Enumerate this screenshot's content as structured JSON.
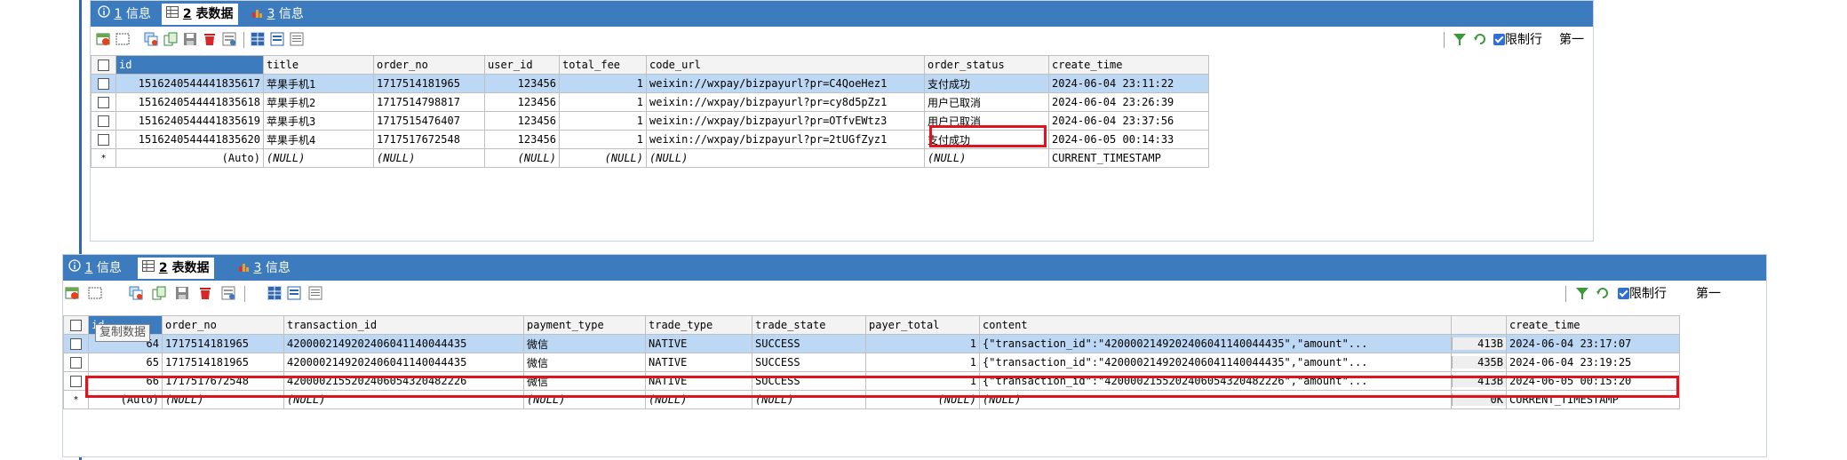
{
  "colors": {
    "tabbar": "#3d7bbf",
    "selection": "#bcd8f4",
    "highlight": "#e0141e"
  },
  "panel1": {
    "tabs": [
      {
        "num": "1",
        "label": "信息",
        "icon": "info-icon"
      },
      {
        "num": "2",
        "label": "表数据",
        "icon": "table-icon"
      },
      {
        "num": "3",
        "label": "信息",
        "icon": "bar-chart-icon"
      }
    ],
    "toolbar": {
      "limit_label": "限制行",
      "first_label": "第一"
    },
    "columns": [
      "id",
      "title",
      "order_no",
      "user_id",
      "total_fee",
      "code_url",
      "order_status",
      "create_time"
    ],
    "rows": [
      [
        "1516240544441835617",
        "苹果手机1",
        "1717514181965",
        "123456",
        "1",
        "weixin://wxpay/bizpayurl?pr=C4QoeHez1",
        "支付成功",
        "2024-06-04 23:11:22"
      ],
      [
        "1516240544441835618",
        "苹果手机2",
        "1717514798817",
        "123456",
        "1",
        "weixin://wxpay/bizpayurl?pr=cy8d5pZz1",
        "用户已取消",
        "2024-06-04 23:26:39"
      ],
      [
        "1516240544441835619",
        "苹果手机3",
        "1717515476407",
        "123456",
        "1",
        "weixin://wxpay/bizpayurl?pr=OTfvEWtz3",
        "用户已取消",
        "2024-06-04 23:37:56"
      ],
      [
        "1516240544441835620",
        "苹果手机4",
        "1717517672548",
        "123456",
        "1",
        "weixin://wxpay/bizpayurl?pr=2tUGfZyz1",
        "支付成功",
        "2024-06-05 00:14:33"
      ]
    ],
    "new_row": [
      "(Auto)",
      "(NULL)",
      "(NULL)",
      "(NULL)",
      "(NULL)",
      "(NULL)",
      "(NULL)",
      "CURRENT_TIMESTAMP"
    ],
    "new_row_marker": "*"
  },
  "panel2": {
    "tabs": [
      {
        "num": "1",
        "label": "信息",
        "icon": "info-icon"
      },
      {
        "num": "2",
        "label": "表数据",
        "icon": "table-icon"
      },
      {
        "num": "3",
        "label": "信息",
        "icon": "bar-chart-icon"
      }
    ],
    "toolbar": {
      "limit_label": "限制行",
      "first_label": "第一"
    },
    "columns": [
      "id",
      "order_no",
      "transaction_id",
      "payment_type",
      "trade_type",
      "trade_state",
      "payer_total",
      "content",
      "",
      "create_time"
    ],
    "rows": [
      [
        "64",
        "1717514181965",
        "4200002149202406041140044435",
        "微信",
        "NATIVE",
        "SUCCESS",
        "1",
        "{\"transaction_id\":\"4200002149202406041140044435\",\"amount\"...",
        "413B",
        "2024-06-04 23:17:07"
      ],
      [
        "65",
        "1717514181965",
        "4200002149202406041140044435",
        "微信",
        "NATIVE",
        "SUCCESS",
        "1",
        "{\"transaction_id\":\"4200002149202406041140044435\",\"amount\"...",
        "435B",
        "2024-06-04 23:19:25"
      ],
      [
        "66",
        "1717517672548",
        "4200002155202406054320482226",
        "微信",
        "NATIVE",
        "SUCCESS",
        "1",
        "{\"transaction_id\":\"4200002155202406054320482226\",\"amount\"...",
        "413B",
        "2024-06-05 00:15:20"
      ]
    ],
    "new_row": [
      "(Auto)",
      "(NULL)",
      "(NULL)",
      "(NULL)",
      "(NULL)",
      "(NULL)",
      "(NULL)",
      "(NULL)",
      "0K",
      "CURRENT_TIMESTAMP"
    ],
    "new_row_marker": "*",
    "tooltip": "复制数据"
  }
}
